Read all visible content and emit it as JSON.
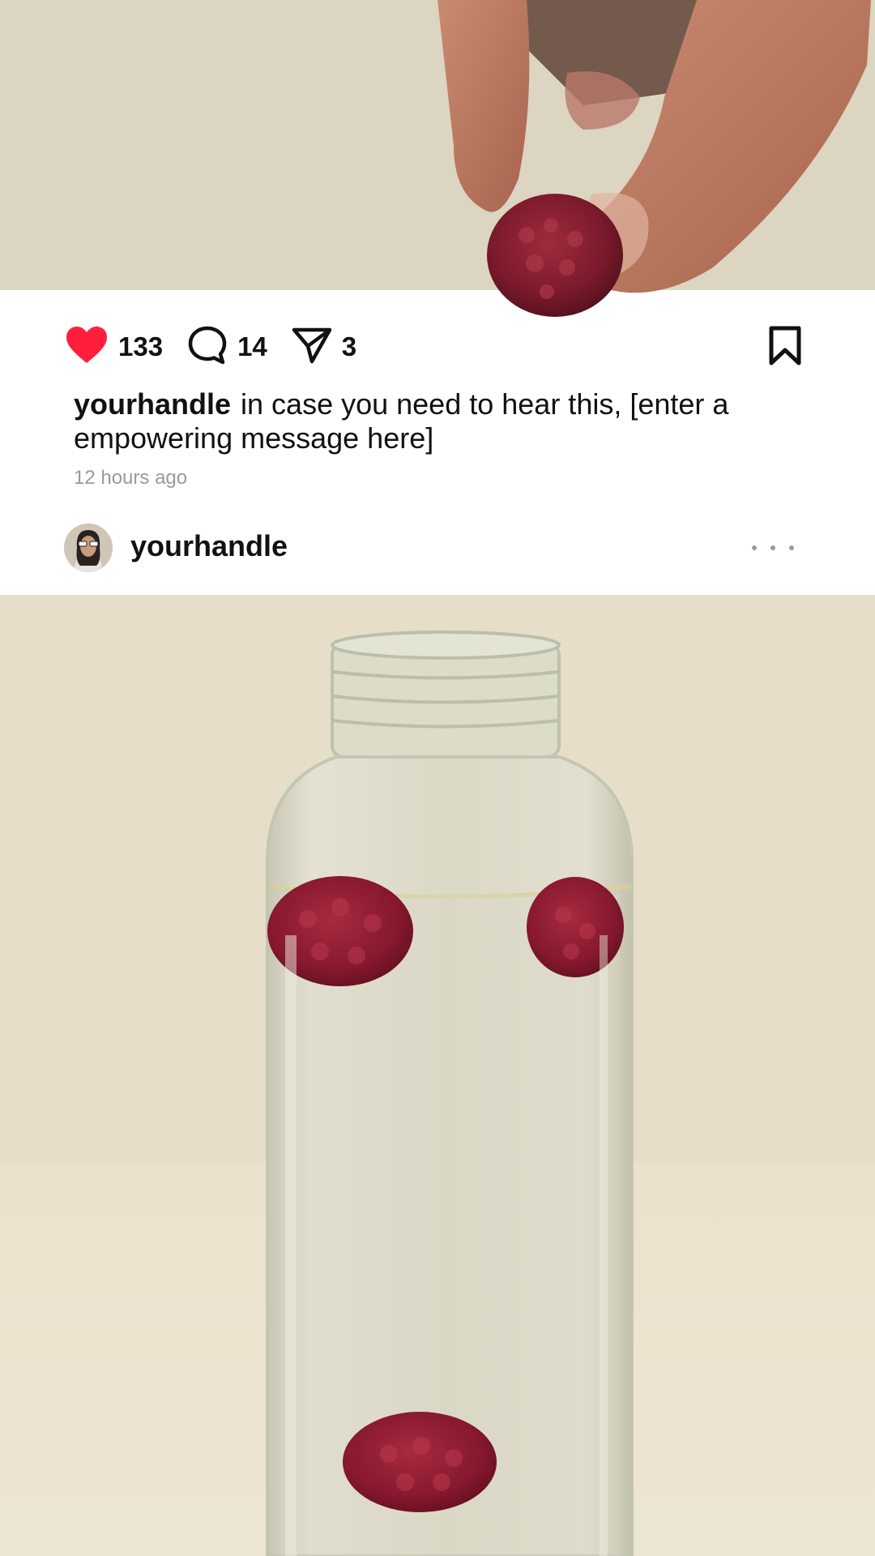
{
  "top_photo": {
    "alt": "hand dropping raspberry"
  },
  "actions": {
    "likes": "133",
    "comments": "14",
    "shares": "3",
    "like_color": "#ff1f3d"
  },
  "caption": {
    "handle": "yourhandle",
    "text": "in case you need to hear this, [enter a empowering message here]",
    "time": "12 hours ago"
  },
  "next_post": {
    "handle": "yourhandle",
    "photo_alt": "glass bottle of water with raspberries"
  },
  "icons": {
    "like": "heart-icon",
    "comment": "comment-bubble-icon",
    "share": "paper-plane-icon",
    "save": "bookmark-icon",
    "more": "more-dots-icon"
  }
}
